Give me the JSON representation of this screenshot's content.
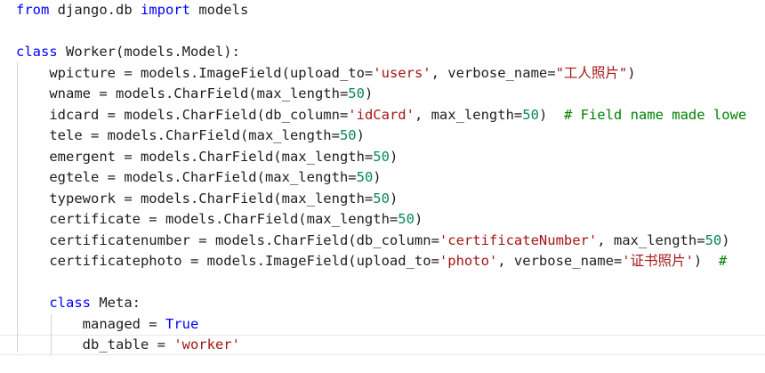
{
  "editor": {
    "lines": [
      [
        {
          "t": "from",
          "c": "kw"
        },
        {
          "t": " django.db ",
          "c": "plain"
        },
        {
          "t": "import",
          "c": "kw"
        },
        {
          "t": " models",
          "c": "plain"
        }
      ],
      [],
      [
        {
          "t": "class",
          "c": "kw"
        },
        {
          "t": " Worker(models.Model):",
          "c": "plain"
        }
      ],
      [
        {
          "t": "    wpicture = models.ImageField(upload_to=",
          "c": "plain"
        },
        {
          "t": "'users'",
          "c": "str"
        },
        {
          "t": ", verbose_name=",
          "c": "plain"
        },
        {
          "t": "\"工人照片\"",
          "c": "str"
        },
        {
          "t": ")",
          "c": "plain"
        }
      ],
      [
        {
          "t": "    wname = models.CharField(max_length=",
          "c": "plain"
        },
        {
          "t": "50",
          "c": "num"
        },
        {
          "t": ")",
          "c": "plain"
        }
      ],
      [
        {
          "t": "    idcard = models.CharField(db_column=",
          "c": "plain"
        },
        {
          "t": "'idCard'",
          "c": "str"
        },
        {
          "t": ", max_length=",
          "c": "plain"
        },
        {
          "t": "50",
          "c": "num"
        },
        {
          "t": ")  ",
          "c": "plain"
        },
        {
          "t": "# Field name made lowe",
          "c": "cmt"
        }
      ],
      [
        {
          "t": "    tele = models.CharField(max_length=",
          "c": "plain"
        },
        {
          "t": "50",
          "c": "num"
        },
        {
          "t": ")",
          "c": "plain"
        }
      ],
      [
        {
          "t": "    emergent = models.CharField(max_length=",
          "c": "plain"
        },
        {
          "t": "50",
          "c": "num"
        },
        {
          "t": ")",
          "c": "plain"
        }
      ],
      [
        {
          "t": "    egtele = models.CharField(max_length=",
          "c": "plain"
        },
        {
          "t": "50",
          "c": "num"
        },
        {
          "t": ")",
          "c": "plain"
        }
      ],
      [
        {
          "t": "    typework = models.CharField(max_length=",
          "c": "plain"
        },
        {
          "t": "50",
          "c": "num"
        },
        {
          "t": ")",
          "c": "plain"
        }
      ],
      [
        {
          "t": "    certificate = models.CharField(max_length=",
          "c": "plain"
        },
        {
          "t": "50",
          "c": "num"
        },
        {
          "t": ")",
          "c": "plain"
        }
      ],
      [
        {
          "t": "    certificatenumber = models.CharField(db_column=",
          "c": "plain"
        },
        {
          "t": "'certificateNumber'",
          "c": "str"
        },
        {
          "t": ", max_length=",
          "c": "plain"
        },
        {
          "t": "50",
          "c": "num"
        },
        {
          "t": ")",
          "c": "plain"
        }
      ],
      [
        {
          "t": "    certificatephoto = models.ImageField(upload_to=",
          "c": "plain"
        },
        {
          "t": "'photo'",
          "c": "str"
        },
        {
          "t": ", verbose_name=",
          "c": "plain"
        },
        {
          "t": "'证书照片'",
          "c": "str"
        },
        {
          "t": ")  ",
          "c": "plain"
        },
        {
          "t": "#",
          "c": "cmt"
        }
      ],
      [],
      [
        {
          "t": "    ",
          "c": "plain"
        },
        {
          "t": "class",
          "c": "kw"
        },
        {
          "t": " Meta:",
          "c": "plain"
        }
      ],
      [
        {
          "t": "        managed = ",
          "c": "plain"
        },
        {
          "t": "True",
          "c": "kw"
        }
      ],
      [
        {
          "t": "        db_table = ",
          "c": "plain"
        },
        {
          "t": "'worker'",
          "c": "str"
        }
      ]
    ]
  },
  "colors": {
    "keyword": "#0000ff",
    "string": "#a31515",
    "number": "#098658",
    "comment": "#008000",
    "text": "#1e1e1e",
    "background": "#ffffff",
    "indent_guide": "#d3d3d3"
  }
}
